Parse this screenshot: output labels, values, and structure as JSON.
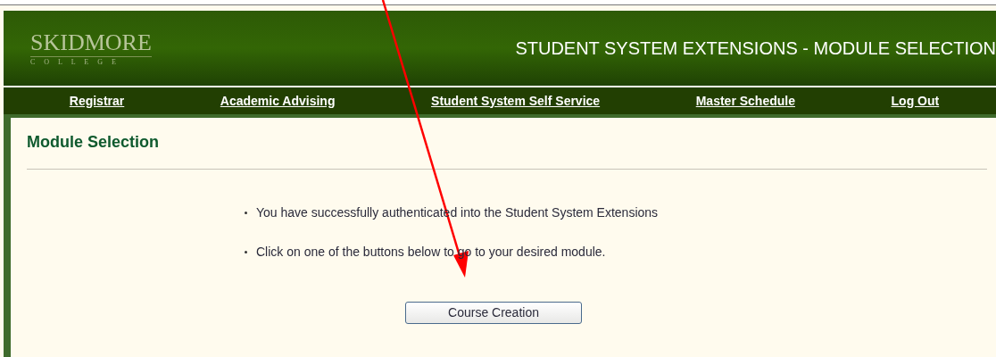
{
  "header": {
    "logo": {
      "name": "SKIDMORE",
      "subtitle": "C O L L E G E"
    },
    "title": "STUDENT SYSTEM EXTENSIONS - MODULE SELECTION"
  },
  "nav": [
    "Registrar",
    "Academic Advising",
    "Student System Self Service",
    "Master Schedule",
    "Log Out"
  ],
  "content": {
    "heading": "Module Selection",
    "bullets": [
      "You have successfully authenticated into the Student System Extensions",
      "Click on one of the buttons below to go to your desired module."
    ],
    "buttons": [
      "Course Creation"
    ]
  }
}
